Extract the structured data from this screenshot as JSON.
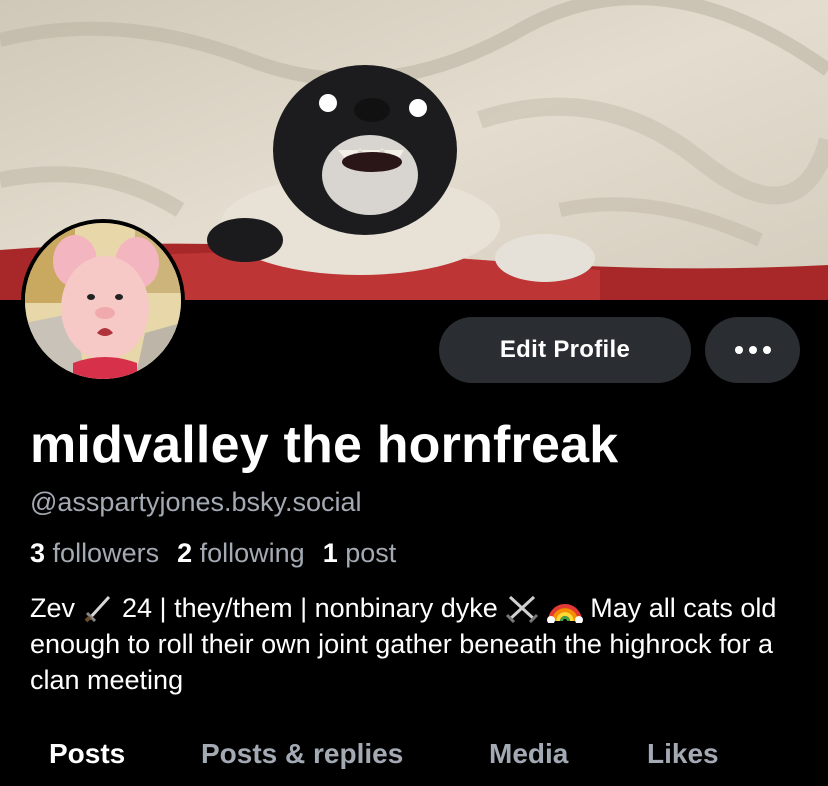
{
  "profile": {
    "display_name": "midvalley the hornfreak",
    "handle": "@asspartyjones.bsky.social",
    "followers_count": "3",
    "followers_label": "followers",
    "following_count": "2",
    "following_label": "following",
    "posts_count": "1",
    "posts_label": "post",
    "bio": {
      "part1": "Zev ",
      "part2": " 24 | they/them | nonbinary dyke ",
      "part3": " May all cats old enough to roll their own joint gather beneath the highrock for a clan meeting",
      "icons": [
        "dagger-icon",
        "crossed-swords-icon",
        "rainbow-icon"
      ]
    }
  },
  "actions": {
    "edit_profile_label": "Edit Profile",
    "more_icon": "ellipsis-icon"
  },
  "tabs": [
    {
      "label": "Posts",
      "active": true
    },
    {
      "label": "Posts & replies",
      "active": false
    },
    {
      "label": "Media",
      "active": false
    },
    {
      "label": "Likes",
      "active": false
    }
  ],
  "colors": {
    "background": "#000000",
    "button": "#2a2d31",
    "muted_text": "#a3aab4",
    "text": "#ffffff"
  }
}
